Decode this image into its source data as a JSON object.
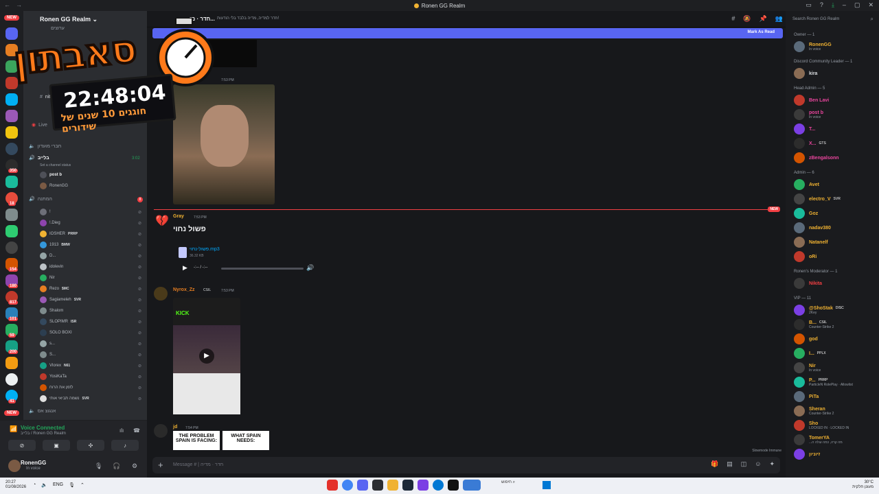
{
  "window": {
    "title": "Ronen GG Realm"
  },
  "server": {
    "name": "Ronen GG Realm"
  },
  "rail": {
    "new_label": "NEW",
    "badges": [
      "17",
      "6",
      "4",
      "350",
      "18",
      "154",
      "180",
      "817",
      "101",
      "59",
      "200",
      "41"
    ]
  },
  "channels": {
    "top": [
      "ערוצים",
      "nitro",
      "Live"
    ],
    "voice_channels": [
      {
        "name": "חברי מועדון",
        "timer": ""
      },
      {
        "name": "בלייב",
        "timer": "3:02",
        "status": "Set a channel status"
      }
    ],
    "live_users": [
      "post b",
      "RonenGG"
    ],
    "waiting_channel": {
      "name": "המתנה",
      "count": "8"
    },
    "waiting_users": [
      {
        "name": "!",
        "tag": ""
      },
      {
        "name": "!.Dieg",
        "tag": ""
      },
      {
        "name": "IOSHER",
        "tag": "PRRP"
      },
      {
        "name": "1913",
        "tag": "BMW"
      },
      {
        "name": "D...",
        "tag": ""
      },
      {
        "name": "idolevin",
        "tag": ""
      },
      {
        "name": "Nir",
        "tag": ""
      },
      {
        "name": "Rezo",
        "tag": "$MC"
      },
      {
        "name": "Sagiameleh",
        "tag": "SVR"
      },
      {
        "name": "Shalom",
        "tag": ""
      },
      {
        "name": "SLOPIMR",
        "tag": "ISR"
      },
      {
        "name": "SOLO BOXI",
        "tag": ""
      },
      {
        "name": "s...",
        "tag": ""
      },
      {
        "name": "S...",
        "tag": ""
      },
      {
        "name": "Vlorex",
        "tag": "N61"
      },
      {
        "name": "YosiKaTa",
        "tag": ""
      },
      {
        "name": "לזמן את הרוח",
        "tag": ""
      },
      {
        "name": "נשמה תביאי אותי",
        "tag": "SVR"
      }
    ],
    "bottom": "אנגוצ אס"
  },
  "voice": {
    "title": "Voice Connected",
    "sub": "בלייב / Ronen GG Realm"
  },
  "user": {
    "name": "RonenGG",
    "status": "In voice"
  },
  "main": {
    "channel": "חדר · מו...",
    "topic": "חדר למדיה, מדיה בלבד בלי הודעות!",
    "mark_read": "Mark As Read",
    "messages": [
      {
        "time": "7:53 PM"
      },
      {
        "name": "Gray",
        "time": "7:53 PM",
        "text": "פשול נחוי",
        "file": "פשול-נחוי.mp3",
        "size": "36.32 KB",
        "duration": "-:-- / -:--"
      },
      {
        "name": "Nyrox_Zz",
        "tag": "CSIL",
        "time": "7:53 PM",
        "video_text": "KICK"
      },
      {
        "name": "jd",
        "time": "7:54 PM",
        "cap1": "THE PROBLEM SPAIN IS FACING:",
        "cap2": "WHAT SPAIN NEEDS:"
      }
    ],
    "new_label": "NEW",
    "slowmode": "Slowmode Immune",
    "placeholder": "Message # | חדר · מדיה"
  },
  "members": {
    "search": "Search Ronen GG Realm",
    "groups": [
      {
        "role": "Owner — 1",
        "users": [
          {
            "n": "RonenGG",
            "s": "In voice",
            "c": "#f0b232"
          }
        ]
      },
      {
        "role": "Discord Community Leader — 1",
        "users": [
          {
            "n": "kira",
            "s": "",
            "c": "#dbdee1"
          }
        ]
      },
      {
        "role": "Head Admin — 5",
        "users": [
          {
            "n": "Ben Lavi",
            "s": "",
            "c": "#eb459e"
          },
          {
            "n": "post b",
            "s": "In voice",
            "c": "#eb459e"
          },
          {
            "n": "T...",
            "s": "",
            "c": "#eb459e"
          },
          {
            "n": "X...",
            "s": "",
            "c": "#eb459e",
            "t": "GTS"
          },
          {
            "n": "zBengalsonn",
            "s": "",
            "c": "#eb459e"
          }
        ]
      },
      {
        "role": "Admin — 6",
        "users": [
          {
            "n": "Avet",
            "s": "",
            "c": "#f0b232"
          },
          {
            "n": "electro_V",
            "s": "",
            "c": "#f0b232",
            "t": "SVR"
          },
          {
            "n": "Goz",
            "s": "",
            "c": "#f0b232"
          },
          {
            "n": "nadav380",
            "s": "",
            "c": "#f0b232"
          },
          {
            "n": "Natanelf",
            "s": "",
            "c": "#f0b232"
          },
          {
            "n": "oRi",
            "s": "",
            "c": "#f0b232"
          }
        ]
      },
      {
        "role": "Ronen's Moderator — 1",
        "users": [
          {
            "n": "Nikita",
            "s": "",
            "c": "#f23f43"
          }
        ]
      },
      {
        "role": "VIP — 11",
        "users": [
          {
            "n": "@ShoStak",
            "s": "2Key",
            "c": "#f0b232",
            "t": "DISC"
          },
          {
            "n": "B...",
            "s": "Counter-Strike 2",
            "c": "#f0b232",
            "t": "CSIL"
          },
          {
            "n": "god",
            "s": "",
            "c": "#f0b232"
          },
          {
            "n": "I...",
            "s": "",
            "c": "#f0b232",
            "t": "PPLX"
          },
          {
            "n": "Nir",
            "s": "In voice",
            "c": "#f0b232"
          },
          {
            "n": "P...",
            "s": "ParticleN RolePlay · Allowlist",
            "c": "#f0b232",
            "t": "PRRP"
          },
          {
            "n": "PiTa",
            "s": "",
            "c": "#f0b232"
          },
          {
            "n": "Sheran",
            "s": "Counter-Strike 2",
            "c": "#f0b232"
          },
          {
            "n": "Sho",
            "s": "LOCKED IN · LOCKED IN",
            "c": "#f0b232"
          },
          {
            "n": "TomerYA",
            "s": "...מה קרה, כמה עולה ה",
            "c": "#f0b232"
          },
          {
            "n": "זיוניון",
            "s": "",
            "c": "#f0b232"
          }
        ]
      }
    ]
  },
  "overlay": {
    "title": "סאבתון",
    "time": "22:48:04",
    "sub": "חוגגים 10 שנים של שידורים"
  },
  "taskbar": {
    "time": "20:27",
    "date": "01/08/2026",
    "lang": "ENG",
    "search": "חיפוש",
    "weather_temp": "30°C",
    "weather": "מעונן חלקית"
  }
}
